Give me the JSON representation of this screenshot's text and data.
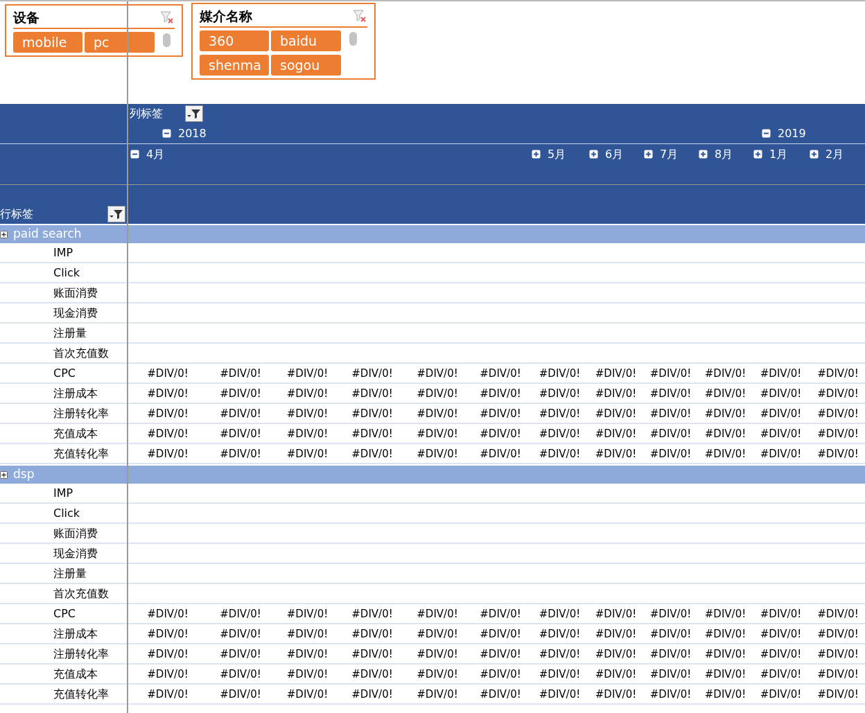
{
  "slicers": [
    {
      "title": "设备",
      "items": [
        {
          "label": "mobile",
          "selected": true
        },
        {
          "label": "pc",
          "selected": true
        }
      ]
    },
    {
      "title": "媒介名称",
      "items": [
        {
          "label": "360",
          "selected": true
        },
        {
          "label": "baidu",
          "selected": true
        },
        {
          "label": "shenma",
          "selected": true
        },
        {
          "label": "sogou",
          "selected": true
        }
      ]
    }
  ],
  "pivot": {
    "column_label": "列标签",
    "row_label": "行标签",
    "years": [
      {
        "label": "2018",
        "expanded": true
      },
      {
        "label": "2019",
        "expanded": true
      }
    ],
    "months": [
      {
        "label": "4月",
        "expanded": true
      },
      {
        "label": "5月",
        "expanded": false
      },
      {
        "label": "6月",
        "expanded": false
      },
      {
        "label": "7月",
        "expanded": false
      },
      {
        "label": "8月",
        "expanded": false
      },
      {
        "label": "1月",
        "expanded": false
      },
      {
        "label": "2月",
        "expanded": false
      }
    ],
    "groups": [
      {
        "label": "paid search",
        "rows": [
          {
            "label": "IMP"
          },
          {
            "label": "Click"
          },
          {
            "label": "账面消费"
          },
          {
            "label": "现金消费"
          },
          {
            "label": "注册量"
          },
          {
            "label": "首次充值数"
          },
          {
            "label": "CPC",
            "values": [
              "#DIV/0!",
              "#DIV/0!",
              "#DIV/0!",
              "#DIV/0!",
              "#DIV/0!",
              "#DIV/0!",
              "#DIV/0!",
              "#DIV/0!",
              "#DIV/0!",
              "#DIV/0!",
              "#DIV/0!",
              "#DIV/0!"
            ]
          },
          {
            "label": "注册成本",
            "values": [
              "#DIV/0!",
              "#DIV/0!",
              "#DIV/0!",
              "#DIV/0!",
              "#DIV/0!",
              "#DIV/0!",
              "#DIV/0!",
              "#DIV/0!",
              "#DIV/0!",
              "#DIV/0!",
              "#DIV/0!",
              "#DIV/0!"
            ]
          },
          {
            "label": "注册转化率",
            "values": [
              "#DIV/0!",
              "#DIV/0!",
              "#DIV/0!",
              "#DIV/0!",
              "#DIV/0!",
              "#DIV/0!",
              "#DIV/0!",
              "#DIV/0!",
              "#DIV/0!",
              "#DIV/0!",
              "#DIV/0!",
              "#DIV/0!"
            ]
          },
          {
            "label": "充值成本",
            "values": [
              "#DIV/0!",
              "#DIV/0!",
              "#DIV/0!",
              "#DIV/0!",
              "#DIV/0!",
              "#DIV/0!",
              "#DIV/0!",
              "#DIV/0!",
              "#DIV/0!",
              "#DIV/0!",
              "#DIV/0!",
              "#DIV/0!"
            ]
          },
          {
            "label": "充值转化率",
            "values": [
              "#DIV/0!",
              "#DIV/0!",
              "#DIV/0!",
              "#DIV/0!",
              "#DIV/0!",
              "#DIV/0!",
              "#DIV/0!",
              "#DIV/0!",
              "#DIV/0!",
              "#DIV/0!",
              "#DIV/0!",
              "#DIV/0!"
            ]
          }
        ]
      },
      {
        "label": "dsp",
        "rows": [
          {
            "label": "IMP"
          },
          {
            "label": "Click"
          },
          {
            "label": "账面消费"
          },
          {
            "label": "现金消费"
          },
          {
            "label": "注册量"
          },
          {
            "label": "首次充值数"
          },
          {
            "label": "CPC",
            "values": [
              "#DIV/0!",
              "#DIV/0!",
              "#DIV/0!",
              "#DIV/0!",
              "#DIV/0!",
              "#DIV/0!",
              "#DIV/0!",
              "#DIV/0!",
              "#DIV/0!",
              "#DIV/0!",
              "#DIV/0!",
              "#DIV/0!"
            ]
          },
          {
            "label": "注册成本",
            "values": [
              "#DIV/0!",
              "#DIV/0!",
              "#DIV/0!",
              "#DIV/0!",
              "#DIV/0!",
              "#DIV/0!",
              "#DIV/0!",
              "#DIV/0!",
              "#DIV/0!",
              "#DIV/0!",
              "#DIV/0!",
              "#DIV/0!"
            ]
          },
          {
            "label": "注册转化率",
            "values": [
              "#DIV/0!",
              "#DIV/0!",
              "#DIV/0!",
              "#DIV/0!",
              "#DIV/0!",
              "#DIV/0!",
              "#DIV/0!",
              "#DIV/0!",
              "#DIV/0!",
              "#DIV/0!",
              "#DIV/0!",
              "#DIV/0!"
            ]
          },
          {
            "label": "充值成本",
            "values": [
              "#DIV/0!",
              "#DIV/0!",
              "#DIV/0!",
              "#DIV/0!",
              "#DIV/0!",
              "#DIV/0!",
              "#DIV/0!",
              "#DIV/0!",
              "#DIV/0!",
              "#DIV/0!",
              "#DIV/0!",
              "#DIV/0!"
            ]
          },
          {
            "label": "充值转化率",
            "values": [
              "#DIV/0!",
              "#DIV/0!",
              "#DIV/0!",
              "#DIV/0!",
              "#DIV/0!",
              "#DIV/0!",
              "#DIV/0!",
              "#DIV/0!",
              "#DIV/0!",
              "#DIV/0!",
              "#DIV/0!",
              "#DIV/0!"
            ]
          }
        ]
      }
    ]
  }
}
